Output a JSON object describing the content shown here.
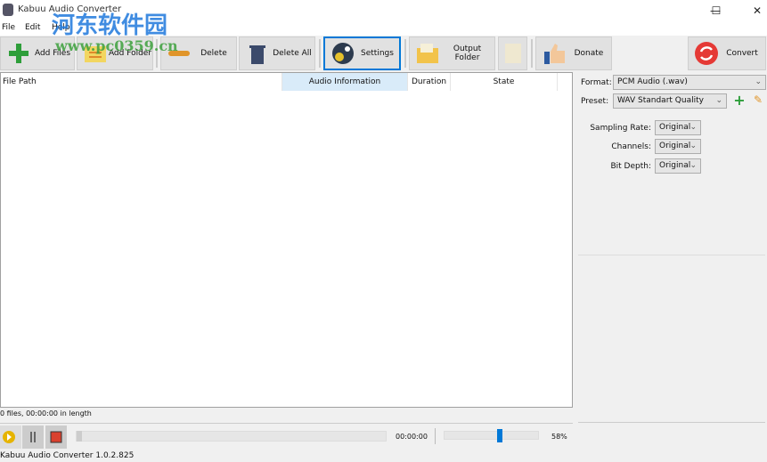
{
  "window": {
    "title": "Kabuu Audio Converter",
    "minimize": "—",
    "maximize": "☐",
    "close": "✕"
  },
  "menu": [
    "File",
    "Edit",
    "Help"
  ],
  "toolbar": {
    "add_files": "Add Files",
    "add_folder": "Add Folder",
    "delete": "Delete",
    "delete_all": "Delete All",
    "settings": "Settings",
    "output_folder": "Output Folder",
    "donate": "Donate",
    "convert": "Convert"
  },
  "list": {
    "columns": [
      "File Path",
      "Audio Information",
      "Duration",
      "State"
    ]
  },
  "panel": {
    "format_label": "Format:",
    "format_value": "PCM Audio (.wav)",
    "preset_label": "Preset:",
    "preset_value": "WAV Standart Quality",
    "sampling_label": "Sampling Rate:",
    "sampling_value": "Original",
    "channels_label": "Channels:",
    "channels_value": "Original",
    "bitdepth_label": "Bit Depth:",
    "bitdepth_value": "Original"
  },
  "status": {
    "summary": "0 files, 00:00:00 in length",
    "time": "00:00:00",
    "volume_label": "58%",
    "volume": 58,
    "progress": 0,
    "version": "Kabuu Audio Converter 1.0.2.825"
  },
  "watermark": {
    "title": "河东软件园",
    "url": "www.pc0359.cn"
  },
  "colors": {
    "accent": "#0078d7",
    "convert": "#e53935"
  }
}
